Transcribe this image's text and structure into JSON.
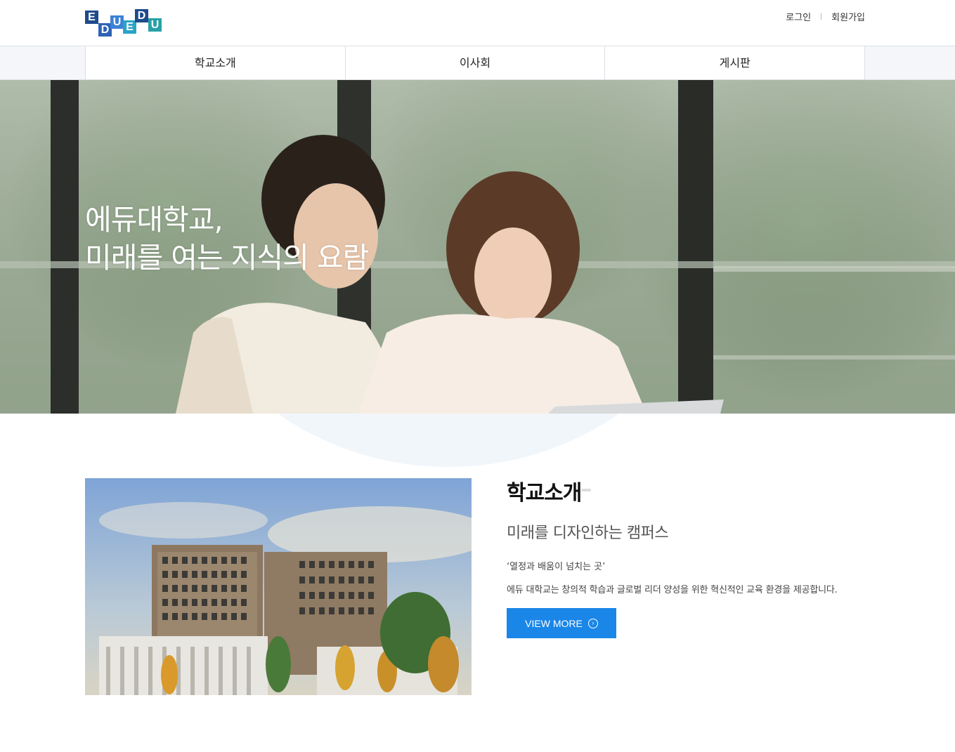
{
  "header": {
    "logo_letters": [
      "E",
      "D",
      "U",
      "E",
      "D",
      "U"
    ],
    "logo_colors": [
      "#1f4a8c",
      "#2d63b5",
      "#3b82d6",
      "#2aa3c6",
      "#1f4a8c",
      "#27a1a8"
    ],
    "login": "로그인",
    "signup": "회원가입"
  },
  "nav": {
    "items": [
      "학교소개",
      "이사회",
      "게시판"
    ]
  },
  "hero": {
    "title_line1": "에듀대학교,",
    "title_line2": "미래를 여는 지식의 요람"
  },
  "intro": {
    "heading": "학교소개",
    "subheading": "미래를 디자인하는 캠퍼스",
    "quote": "‘열정과 배움이 넘치는 곳’",
    "description": "에듀 대학교는 창의적 학습과 글로벌 리더 양성을 위한 혁신적인 교육 환경을 제공합니다.",
    "button_label": "VIEW MORE",
    "button_icon": "chevron-right-circle-icon",
    "accent_color": "#1a86e8"
  }
}
